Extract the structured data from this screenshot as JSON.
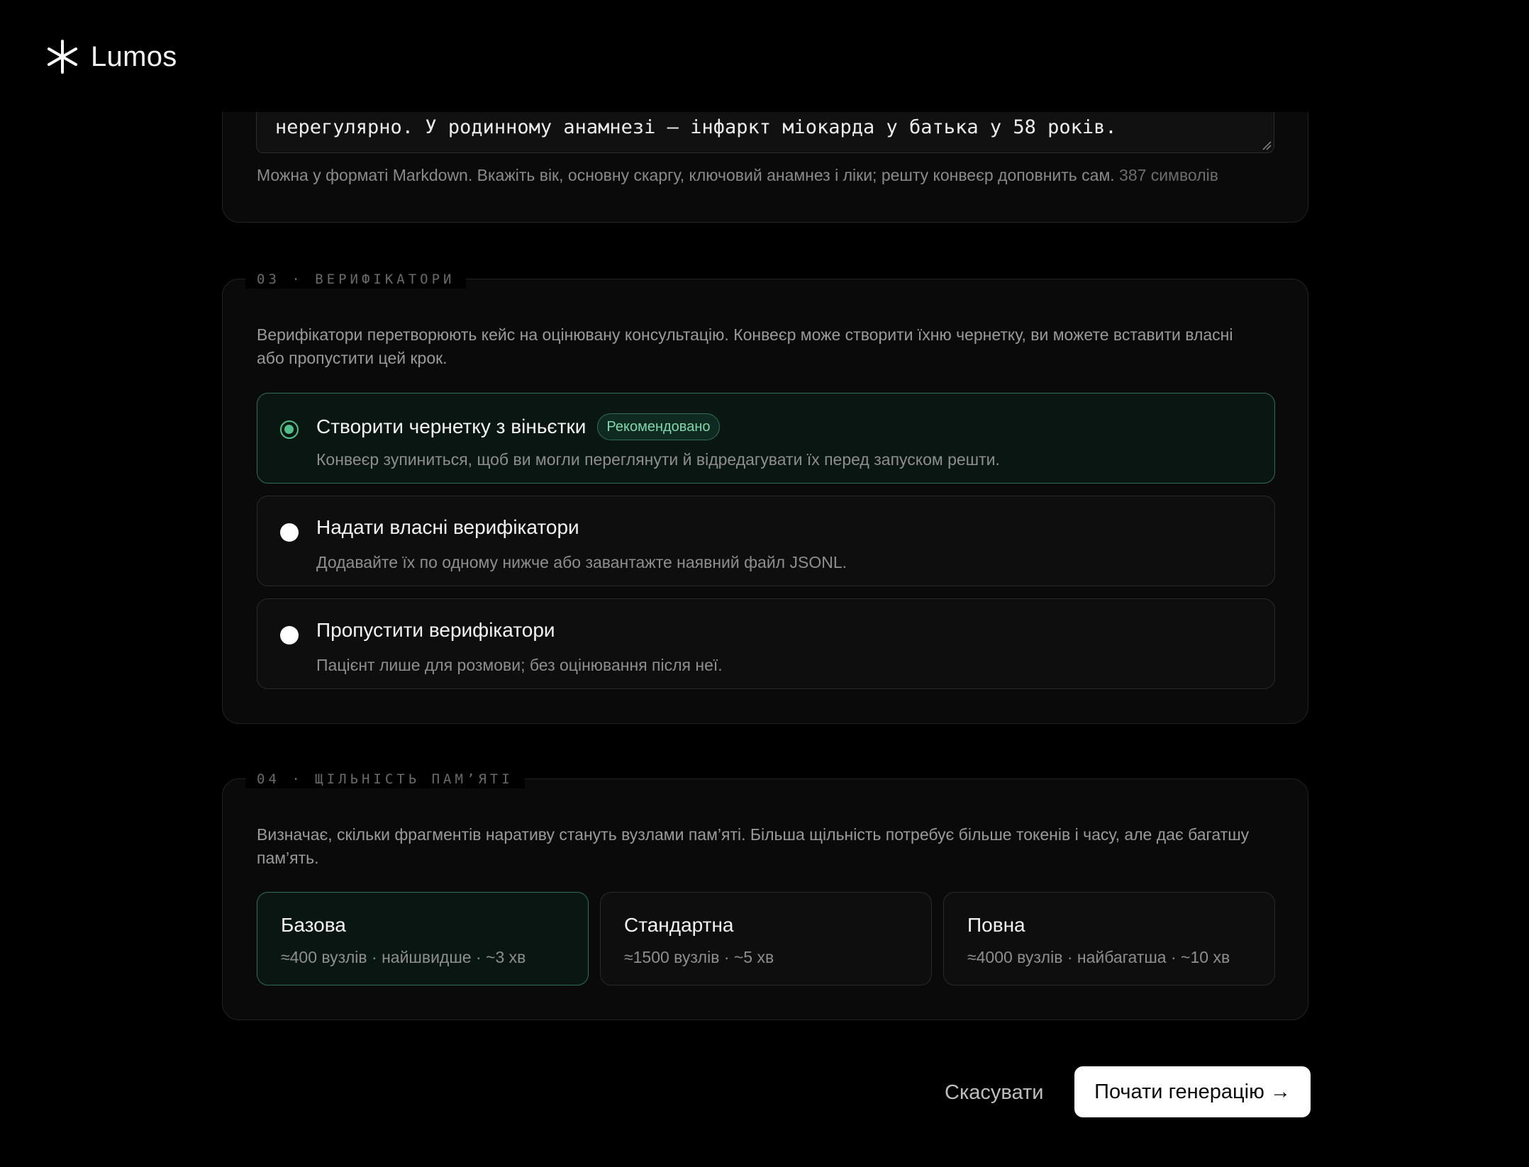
{
  "app": {
    "name": "Lumos",
    "logo_icon": "asterisk-icon"
  },
  "case_section": {
    "textarea_value": "нерегулярно. У родинному анамнезі — інфаркт міокарда у батька у 58 років.",
    "hint": "Можна у форматі Markdown. Вкажіть вік, основну скаргу, ключовий анамнез і ліки; решту конвеєр доповнить сам.",
    "char_count": "387 символів"
  },
  "verifiers": {
    "legend": "03 · ВЕРИФІКАТОРИ",
    "description": "Верифікатори перетворюють кейс на оцінювану консультацію. Конвеєр може створити їхню чернетку, ви можете вставити власні або пропустити цей крок.",
    "options": [
      {
        "title": "Створити чернетку з віньєтки",
        "badge": "Рекомендовано",
        "subtitle": "Конвеєр зупиниться, щоб ви могли переглянути й відредагувати їх перед запуском решти.",
        "selected": true
      },
      {
        "title": "Надати власні верифікатори",
        "subtitle": "Додавайте їх по одному нижче або завантажте наявний файл JSONL.",
        "selected": false
      },
      {
        "title": "Пропустити верифікатори",
        "subtitle": "Пацієнт лише для розмови; без оцінювання після неї.",
        "selected": false
      }
    ]
  },
  "memory_density": {
    "legend": "04 · ЩІЛЬНІСТЬ ПАМ’ЯТІ",
    "description": "Визначає, скільки фрагментів наративу стануть вузлами пам’яті. Більша щільність потребує більше токенів і часу, але дає багатшу пам’ять.",
    "options": [
      {
        "title": "Базова",
        "subtitle": "≈400 вузлів · найшвидше · ~3 хв",
        "selected": true
      },
      {
        "title": "Стандартна",
        "subtitle": "≈1500 вузлів · ~5 хв",
        "selected": false
      },
      {
        "title": "Повна",
        "subtitle": "≈4000 вузлів · найбагатша · ~10 хв",
        "selected": false
      }
    ]
  },
  "actions": {
    "cancel_label": "Скасувати",
    "start_label": "Почати генерацію →"
  },
  "colors": {
    "accent": "#4fbf8b",
    "accent_border": "#2f6e55",
    "background": "#000000",
    "panel": "#0a0a0a"
  }
}
